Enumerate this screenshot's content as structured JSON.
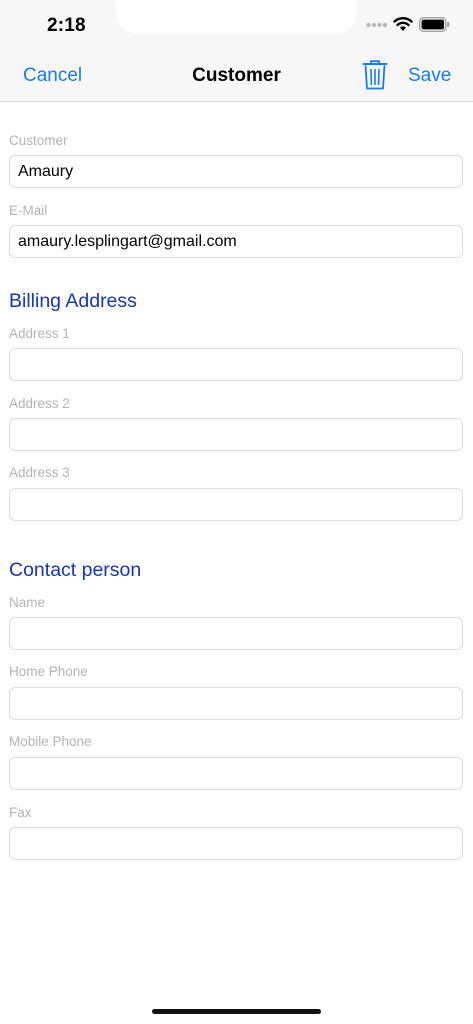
{
  "status_bar": {
    "time": "2:18"
  },
  "nav": {
    "cancel_label": "Cancel",
    "title": "Customer",
    "save_label": "Save"
  },
  "customer": {
    "customer_label": "Customer",
    "customer_value": "Amaury",
    "email_label": "E-Mail",
    "email_value": "amaury.lesplingart@gmail.com"
  },
  "billing": {
    "title": "Billing Address",
    "address1_label": "Address 1",
    "address1_value": "",
    "address2_label": "Address 2",
    "address2_value": "",
    "address3_label": "Address 3",
    "address3_value": ""
  },
  "contact": {
    "title": "Contact person",
    "name_label": "Name",
    "name_value": "",
    "home_phone_label": "Home Phone",
    "home_phone_value": "",
    "mobile_phone_label": "Mobile Phone",
    "mobile_phone_value": "",
    "fax_label": "Fax",
    "fax_value": ""
  },
  "icons": {
    "trash": "trash-icon",
    "wifi": "wifi-icon",
    "battery": "battery-icon",
    "signal": "signal-icon"
  },
  "colors": {
    "accent": "#1a7be6",
    "section_title": "#1a36a8",
    "label": "#b3b3b3"
  }
}
